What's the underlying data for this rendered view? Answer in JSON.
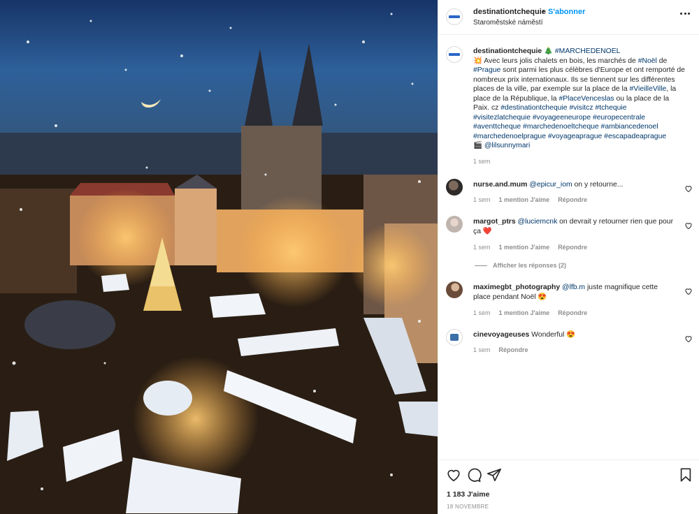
{
  "photo": {
    "alt_subject": ""
  },
  "header": {
    "username": "destinationtchequie",
    "separator": "•",
    "follow_label": "S'abonner",
    "location": "Staroměstské náměstí"
  },
  "caption": {
    "username": "destinationtchequie",
    "tree_emoji": "🎄",
    "tag_main": "#MARCHEDENOEL",
    "star_emoji": "💥",
    "p1": " Avec leurs jolis chalets en bois, les marchés de ",
    "tag_noel": "#Noël",
    "p2": " de ",
    "tag_prague": "#Prague",
    "p3": " sont parmi les plus célèbres d'Europe et ont remporté de nombreux prix internationaux. Ils se tiennent sur les différentes places de la ville, par exemple sur la place de la ",
    "tag_vieille": "#VieilleVille",
    "p4": ", la place de la République, la ",
    "tag_wenc": "#PlaceVenceslas",
    "p5": " ou la place de la Paix. cz ",
    "tags_tail": "#destinationtchequie #visitcz #tchequie #visitezlatchequie #voyageeneurope #europecentrale #aventtcheque #marchedenoeltcheque #ambiancedenoel #marchedenoelprague #voyageaprague #escapadeaprague",
    "camera_emoji": "🎬",
    "credit": "@lilsunnymari",
    "time": "1 sem"
  },
  "comments": [
    {
      "user": "nurse.and.mum",
      "mention": "@epicur_iom",
      "text": " on y retourne...",
      "time": "1 sem",
      "likes": "1 mention J'aime",
      "reply": "Répondre"
    },
    {
      "user": "margot_ptrs",
      "mention": "@luciemcnk",
      "text": " on devrait y retourner rien que pour ça ❤️",
      "time": "1 sem",
      "likes": "1 mention J'aime",
      "reply": "Répondre",
      "view_replies": "Afficher les réponses (2)"
    },
    {
      "user": "maximegbt_photography",
      "mention": "@lfb.m",
      "text": " juste magnifique cette place pendant Noël 😍",
      "time": "1 sem",
      "likes": "1 mention J'aime",
      "reply": "Répondre"
    },
    {
      "user": "cinevoyageuses",
      "mention": "",
      "text": " Wonderful 😍",
      "time": "1 sem",
      "reply": "Répondre"
    }
  ],
  "footer": {
    "likes": "1 183 J'aime",
    "date": "18 NOVEMBRE"
  },
  "colors": {
    "link": "#0095f6",
    "hashtag": "#00376b",
    "muted": "#8e8e8e"
  },
  "icons": [
    "heart-icon",
    "comment-icon",
    "share-icon",
    "bookmark-icon",
    "more-icon"
  ]
}
